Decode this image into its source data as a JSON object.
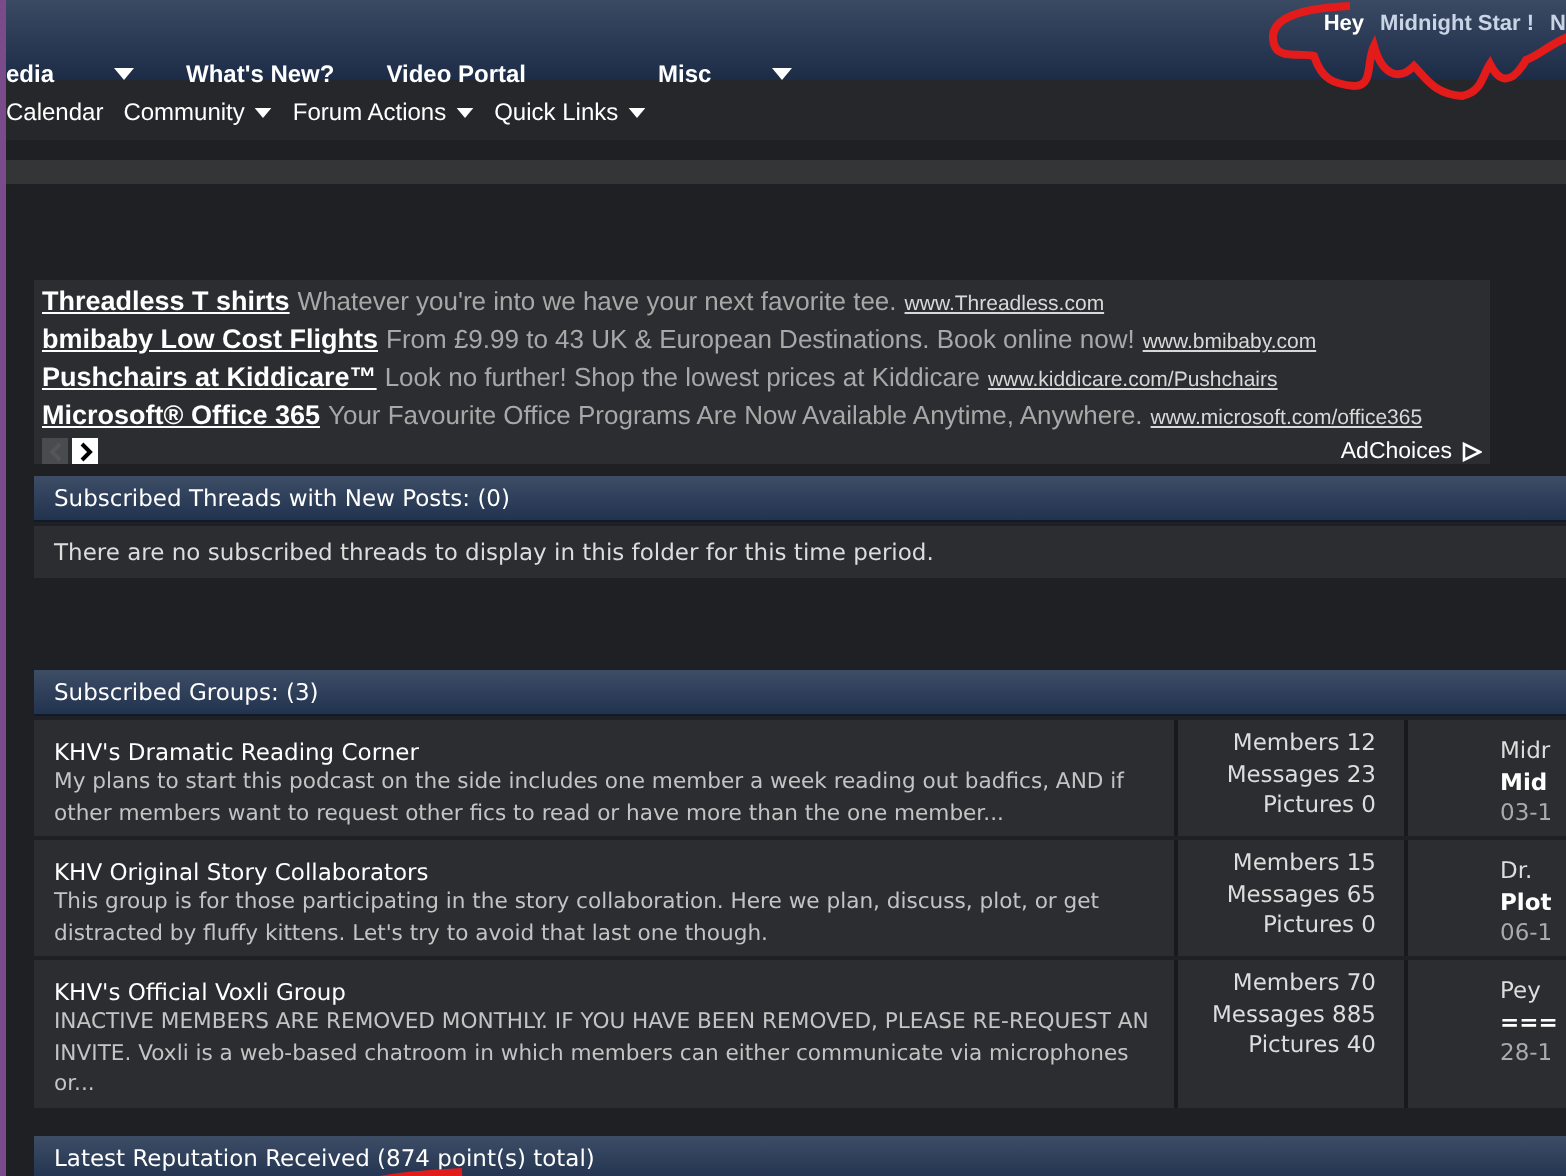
{
  "top_nav": {
    "items": [
      {
        "label": "edia",
        "dropdown": true
      },
      {
        "label": "What's New?",
        "dropdown": false
      },
      {
        "label": "Video Portal",
        "dropdown": false
      },
      {
        "label": "Misc",
        "dropdown": true
      }
    ],
    "greeting": "Hey",
    "username": "Midnight Star !",
    "cut_text": "N"
  },
  "sub_nav": [
    {
      "label": "Calendar",
      "dropdown": false
    },
    {
      "label": "Community",
      "dropdown": true
    },
    {
      "label": "Forum Actions",
      "dropdown": true
    },
    {
      "label": "Quick Links",
      "dropdown": true
    }
  ],
  "ads": {
    "items": [
      {
        "title": "Threadless T shirts",
        "text": "Whatever you're into we have your next favorite tee.",
        "url": "www.Threadless.com"
      },
      {
        "title": "bmibaby Low Cost Flights",
        "text": "From £9.99 to 43 UK & European Destinations. Book online now!",
        "url": "www.bmibaby.com"
      },
      {
        "title": "Pushchairs at Kiddicare™",
        "text": "Look no further! Shop the lowest prices at Kiddicare",
        "url": "www.kiddicare.com/Pushchairs"
      },
      {
        "title": "Microsoft® Office 365",
        "text": "Your Favourite Office Programs Are Now Available Anytime, Anywhere.",
        "url": "www.microsoft.com/office365"
      }
    ],
    "adchoices": "AdChoices"
  },
  "subscribed_threads": {
    "title": "Subscribed Threads with New Posts: (0)",
    "message": "There are no subscribed threads to display in this folder for this time period."
  },
  "subscribed_groups": {
    "title": "Subscribed Groups: (3)",
    "rows": [
      {
        "name": "KHV's Dramatic Reading Corner",
        "description": "My plans to start this podcast on the side includes one member a week reading out badfics, AND if other members want to request other fics to read or have more than the one member...",
        "members": "Members 12",
        "messages": "Messages 23",
        "pictures": "Pictures 0",
        "last_user": "Midr",
        "last_title": "Mid",
        "last_date": "03-1"
      },
      {
        "name": "KHV Original Story Collaborators",
        "description": "This group is for those participating in the story collaboration. Here we plan, discuss, plot, or get distracted by fluffy kittens. Let's try to avoid that last one though.",
        "members": "Members 15",
        "messages": "Messages 65",
        "pictures": "Pictures 0",
        "last_user": "Dr.",
        "last_title": "Plot",
        "last_date": "06-1"
      },
      {
        "name": "KHV's Official Voxli Group",
        "description": "INACTIVE MEMBERS ARE REMOVED MONTHLY. IF YOU HAVE BEEN REMOVED, PLEASE RE-REQUEST AN INVITE. Voxli is a web-based chatroom in which members can either communicate via microphones or...",
        "members": "Members 70",
        "messages": "Messages 885",
        "pictures": "Pictures 40",
        "last_user": "Pey",
        "last_title": "===",
        "last_date": "28-1"
      }
    ]
  },
  "reputation": {
    "title": "Latest Reputation Received (874 point(s) total)"
  }
}
